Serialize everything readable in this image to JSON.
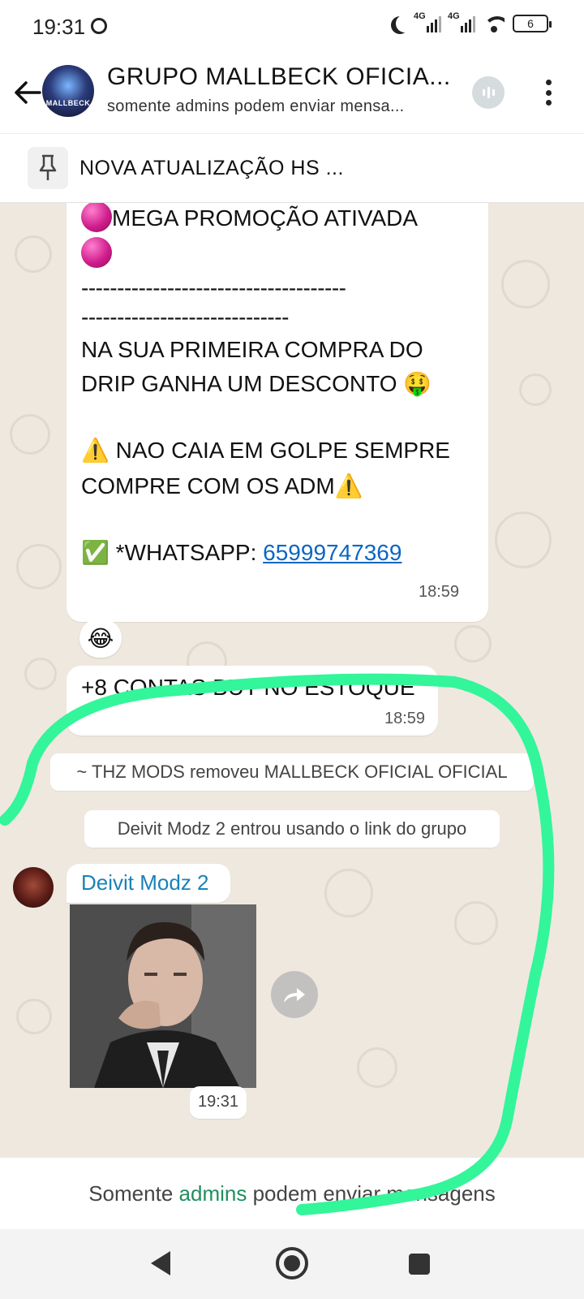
{
  "status_bar": {
    "time": "19:31",
    "network_1": "4G",
    "network_2": "4G",
    "battery": "6"
  },
  "header": {
    "title": "GRUPO MALLBECK OFICIA...",
    "subtitle": "somente admins podem enviar mensa...",
    "avatar_text": "MALLBECK"
  },
  "pinned": {
    "text": "NOVA ATUALIZAÇÃO HS ..."
  },
  "messages": {
    "promo": {
      "line1": "MEGA PROMOÇÃO ATIVADA",
      "dash1": "-------------------------------------",
      "dash2": "-----------------------------",
      "body1": "NA SUA PRIMEIRA COMPRA DO",
      "body2": "DRIP GANHA UM DESCONTO 🤑",
      "warn1": "⚠️ NAO CAIA EM GOLPE SEMPRE",
      "warn2": "COMPRE COM OS ADM⚠️",
      "whatsapp_prefix": "✅ *WHATSAPP: ",
      "whatsapp_number": "65999747369",
      "time": "18:59",
      "reaction": "😂"
    },
    "stock": {
      "text": "+8 CONTAS BUT NO ESTOQUE",
      "time": "18:59"
    },
    "system1": "~ THZ MODS removeu MALLBECK OFICIAL OFICIAL",
    "system2": "Deivit Modz 2 entrou usando o link do grupo",
    "image_msg": {
      "sender": "Deivit Modz 2",
      "time": "19:31"
    }
  },
  "footer": {
    "part1": "Somente ",
    "part2": "admins",
    "part3": " podem enviar mensagens"
  },
  "icons": [
    "back-arrow-icon",
    "group-avatar",
    "voice-chat-icon",
    "kebab-menu-icon",
    "pin-icon",
    "forward-icon",
    "nav-back-icon",
    "nav-home-icon",
    "nav-recents-icon"
  ],
  "colors": {
    "chat_bg": "#efe8df",
    "link": "#0a66c2",
    "sender_name": "#1b82b8",
    "admins_highlight": "#1f8f5f",
    "annotation_stroke": "#33f59a"
  }
}
